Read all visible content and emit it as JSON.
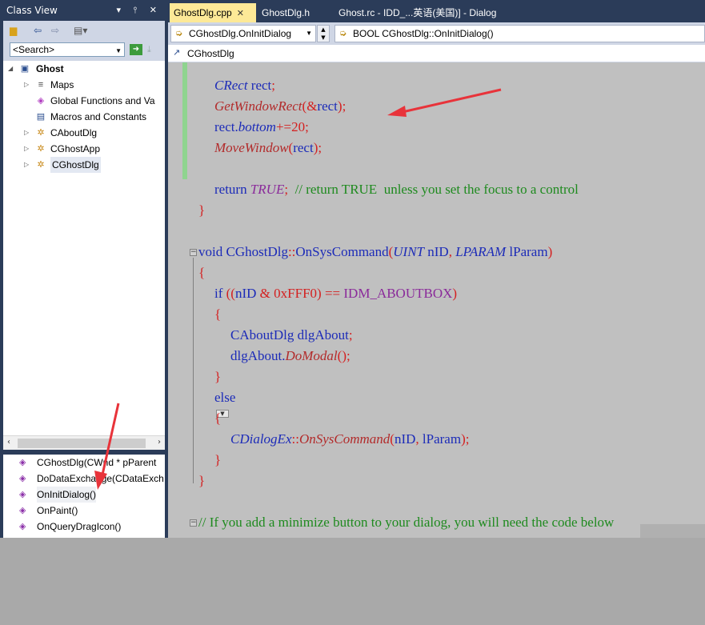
{
  "class_view": {
    "title": "Class View",
    "title_icons": "▾ ⫯ ✕",
    "search": {
      "value": "<Search>"
    },
    "tree": [
      {
        "label": "Ghost",
        "twisty": "◢",
        "icon": "▣",
        "bold": true
      },
      {
        "label": "Maps",
        "twisty": "▷",
        "icon": "≡"
      },
      {
        "label": "Global Functions and Va",
        "twisty": "",
        "icon": "◈"
      },
      {
        "label": "Macros and Constants",
        "twisty": "",
        "icon": "▤"
      },
      {
        "label": "CAboutDlg",
        "twisty": "▷",
        "icon": "✲"
      },
      {
        "label": "CGhostApp",
        "twisty": "▷",
        "icon": "✲"
      },
      {
        "label": "CGhostDlg",
        "twisty": "▷",
        "icon": "✲",
        "selected": true
      }
    ],
    "members": [
      {
        "label": "CGhostDlg(CWnd * pParent"
      },
      {
        "label": "DoDataExchange(CDataExch"
      },
      {
        "label": "OnInitDialog()",
        "selected": true
      },
      {
        "label": "OnPaint()"
      },
      {
        "label": "OnQueryDragIcon()"
      }
    ]
  },
  "editor": {
    "tabs": [
      {
        "label": "GhostDlg.cpp",
        "active": true,
        "close": "✕"
      },
      {
        "label": "GhostDlg.h"
      },
      {
        "label": "Ghost.rc - IDD_...英语(美国)] - Dialog"
      }
    ],
    "nav": {
      "scope": "CGhostDlg.OnInitDialog",
      "member": "BOOL CGhostDlg::OnInitDialog()"
    },
    "breadcrumb": "CGhostDlg"
  },
  "colors": {
    "chrome": "#2b3c59",
    "code_bg": "#c0c0c0",
    "active_tab": "#fde997",
    "arrow": "#e8333a"
  }
}
